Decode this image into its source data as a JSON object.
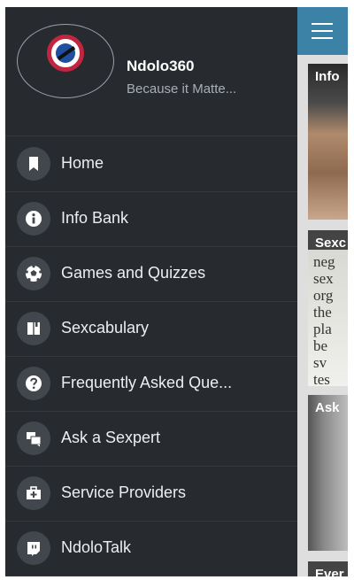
{
  "app": {
    "name": "Ndolo360",
    "tagline": "Because it Matte...",
    "accent": "#3c82a6"
  },
  "menu": [
    {
      "label": "Home",
      "icon": "bookmark-icon"
    },
    {
      "label": "Info Bank",
      "icon": "info-icon"
    },
    {
      "label": "Games and Quizzes",
      "icon": "soccer-ball-icon"
    },
    {
      "label": "Sexcabulary",
      "icon": "book-icon"
    },
    {
      "label": "Frequently Asked Que...",
      "icon": "question-icon"
    },
    {
      "label": "Ask a Sexpert",
      "icon": "chat-bubbles-icon"
    },
    {
      "label": "Service Providers",
      "icon": "medical-kit-icon"
    },
    {
      "label": "NdoloTalk",
      "icon": "chat-box-icon"
    }
  ],
  "background": {
    "cards": [
      {
        "title": "Info"
      },
      {
        "title": "Sexc",
        "words": [
          "neg",
          "sex",
          "org",
          "the",
          "pla",
          "be",
          "sv",
          "tes"
        ]
      },
      {
        "title": "Ask"
      },
      {
        "title": "Ever"
      }
    ]
  }
}
